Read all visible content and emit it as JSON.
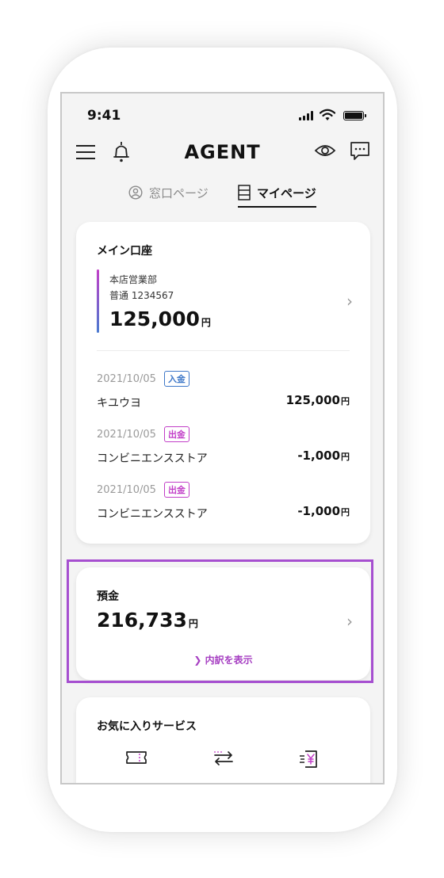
{
  "status_bar": {
    "time": "9:41"
  },
  "header": {
    "logo": "AGENT"
  },
  "tabs": [
    {
      "label": "窓口ページ",
      "active": false
    },
    {
      "label": "マイページ",
      "active": true
    }
  ],
  "main_account": {
    "title": "メイン口座",
    "branch": "本店営業部",
    "account_number": "普通 1234567",
    "balance": "125,000",
    "unit": "円",
    "transactions": [
      {
        "date": "2021/10/05",
        "type": "入金",
        "name": "キユウヨ",
        "amount": "125,000",
        "unit": "円"
      },
      {
        "date": "2021/10/05",
        "type": "出金",
        "name": "コンビニエンスストア",
        "amount": "-1,000",
        "unit": "円"
      },
      {
        "date": "2021/10/05",
        "type": "出金",
        "name": "コンビニエンスストア",
        "amount": "-1,000",
        "unit": "円"
      }
    ]
  },
  "deposit": {
    "title": "預金",
    "amount": "216,733",
    "unit": "円",
    "breakdown_label": "内訳を表示"
  },
  "favorites": {
    "title": "お気に入りサービス",
    "icons": [
      "ticket-icon",
      "transfer-icon",
      "yen-payment-icon"
    ]
  },
  "colors": {
    "accent_purple": "#a64fd0",
    "deposit_badge": "#3f78c8",
    "withdraw_badge": "#c23fc8"
  }
}
